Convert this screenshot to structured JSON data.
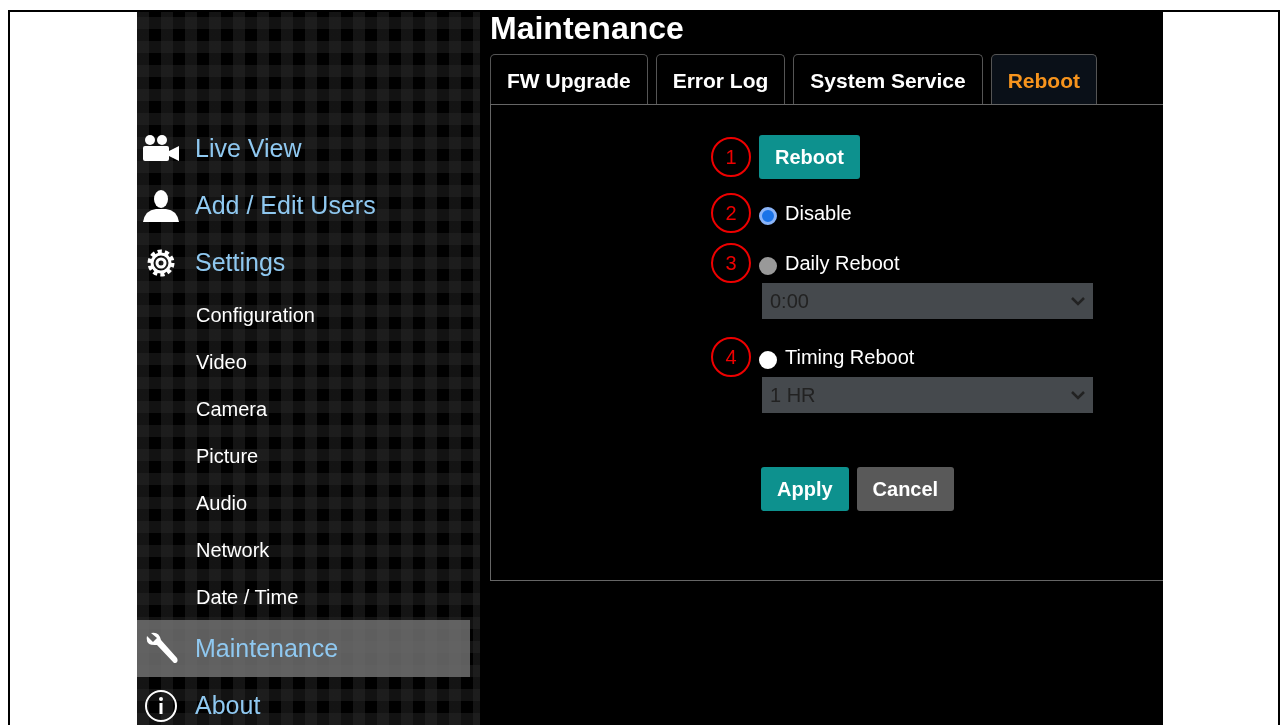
{
  "sidebar": {
    "items": [
      {
        "label": "Live View",
        "kind": "camera",
        "selected": false
      },
      {
        "label": "Add / Edit Users",
        "kind": "user",
        "selected": false
      },
      {
        "label": "Settings",
        "kind": "settings",
        "selected": false
      },
      {
        "label": "Configuration",
        "kind": "sub",
        "selected": false
      },
      {
        "label": "Video",
        "kind": "sub",
        "selected": false
      },
      {
        "label": "Camera",
        "kind": "sub",
        "selected": false
      },
      {
        "label": "Picture",
        "kind": "sub",
        "selected": false
      },
      {
        "label": "Audio",
        "kind": "sub",
        "selected": false
      },
      {
        "label": "Network",
        "kind": "sub",
        "selected": false
      },
      {
        "label": "Date / Time",
        "kind": "sub",
        "selected": false
      },
      {
        "label": "Maintenance",
        "kind": "wrench",
        "selected": true
      },
      {
        "label": "About",
        "kind": "info",
        "selected": false
      }
    ]
  },
  "page_title": "Maintenance",
  "tabs": [
    {
      "label": "FW Upgrade",
      "selected": false
    },
    {
      "label": "Error Log",
      "selected": false
    },
    {
      "label": "System Service",
      "selected": false
    },
    {
      "label": "Reboot",
      "selected": true
    }
  ],
  "reboot_button": {
    "label": "Reboot",
    "marker": "1"
  },
  "options": [
    {
      "label": "Disable",
      "marker": "2",
      "selected": true,
      "disabled": false
    },
    {
      "label": "Daily Reboot",
      "marker": "3",
      "selected": false,
      "disabled": true,
      "dropdown": {
        "value": "0:00",
        "disabled": true
      }
    },
    {
      "label": "Timing Reboot",
      "marker": "4",
      "selected": false,
      "disabled": false,
      "dropdown": {
        "value": "1 HR",
        "disabled": true
      }
    }
  ],
  "buttons": [
    {
      "label": "Apply",
      "kind": "primary"
    },
    {
      "label": "Cancel",
      "kind": "secondary"
    }
  ]
}
